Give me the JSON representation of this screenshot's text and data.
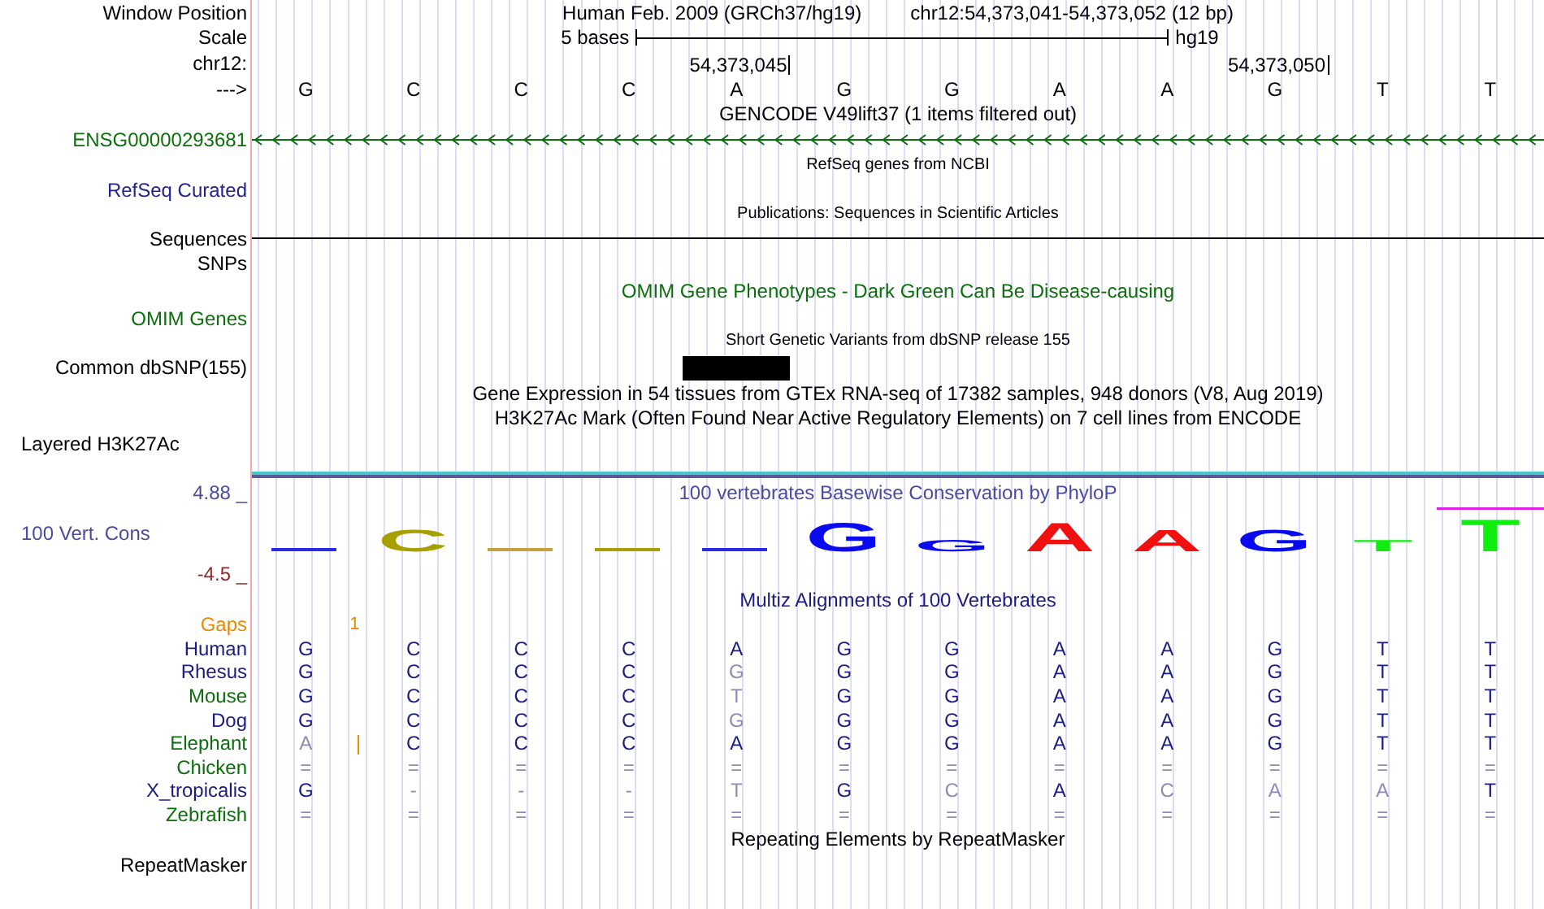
{
  "position": {
    "label": "Window Position",
    "assembly": "Human Feb. 2009 (GRCh37/hg19)",
    "range": "chr12:54,373,041-54,373,052 (12 bp)"
  },
  "scale": {
    "label": "Scale",
    "length": "5 bases",
    "assembly": "hg19"
  },
  "coordinates": {
    "label": "chr12:",
    "ticks": [
      "54,373,045",
      "54,373,050"
    ]
  },
  "bases": {
    "label": "--->",
    "letters": [
      "G",
      "C",
      "C",
      "C",
      "A",
      "G",
      "G",
      "A",
      "A",
      "G",
      "T",
      "T"
    ]
  },
  "gencode": {
    "title": "GENCODE V49lift37 (1 items filtered out)",
    "gene": "ENSG00000293681",
    "color": "#0c6e0c"
  },
  "refseq": {
    "title": "RefSeq genes from NCBI",
    "label": "RefSeq Curated",
    "color": "#23238c"
  },
  "publications": {
    "title": "Publications: Sequences in Scientific Articles",
    "label": "Sequences"
  },
  "snps": {
    "label": "SNPs"
  },
  "omim": {
    "title": "OMIM Gene Phenotypes - Dark Green Can Be Disease-causing",
    "label": "OMIM Genes",
    "color": "#0c6e0c"
  },
  "dbsnp": {
    "title": "Short Genetic Variants from dbSNP release 155",
    "label": "Common dbSNP(155)"
  },
  "gtex": {
    "title": "Gene Expression in 54 tissues from GTEx RNA-seq of 17382 samples, 948 donors (V8, Aug 2019)"
  },
  "h3k27ac": {
    "title": "H3K27Ac Mark (Often Found Near Active Regulatory Elements) on 7 cell lines from ENCODE",
    "label": "Layered H3K27Ac"
  },
  "conservation": {
    "title": "100 vertebrates Basewise Conservation by PhyloP",
    "label": "100 Vert. Cons",
    "max": "4.88 _",
    "min": "-4.5 _",
    "logo": [
      {
        "kind": "flat",
        "color": "#2a2ae0"
      },
      {
        "kind": "mid",
        "letter": "C",
        "color": "#a8a000"
      },
      {
        "kind": "flat",
        "color": "#c8a040"
      },
      {
        "kind": "flat",
        "color": "#a8a000"
      },
      {
        "kind": "flat",
        "color": "#2a2ae0"
      },
      {
        "kind": "tall",
        "letter": "G",
        "color": "#0a0af0"
      },
      {
        "kind": "short",
        "letter": "G",
        "color": "#0a0af0"
      },
      {
        "kind": "tall",
        "letter": "A",
        "color": "#f01010"
      },
      {
        "kind": "mid",
        "letter": "A",
        "color": "#f01010"
      },
      {
        "kind": "mid",
        "letter": "G",
        "color": "#0a0af0"
      },
      {
        "kind": "short",
        "letter": "T",
        "color": "#10ee10"
      },
      {
        "kind": "clipped",
        "letter": "T",
        "color": "#10ee10"
      }
    ]
  },
  "multiz": {
    "title": "Multiz Alignments of 100 Vertebrates",
    "gaps": {
      "label": "Gaps",
      "counts": [
        "1"
      ]
    },
    "species": [
      {
        "name": "Human",
        "color": "#1c1c80",
        "insertion": false,
        "bases": [
          {
            "b": "G",
            "faded": false
          },
          {
            "b": "C",
            "faded": false
          },
          {
            "b": "C",
            "faded": false
          },
          {
            "b": "C",
            "faded": false
          },
          {
            "b": "A",
            "faded": false
          },
          {
            "b": "G",
            "faded": false
          },
          {
            "b": "G",
            "faded": false
          },
          {
            "b": "A",
            "faded": false
          },
          {
            "b": "A",
            "faded": false
          },
          {
            "b": "G",
            "faded": false
          },
          {
            "b": "T",
            "faded": false
          },
          {
            "b": "T",
            "faded": false
          }
        ]
      },
      {
        "name": "Rhesus",
        "color": "#1c1c80",
        "insertion": false,
        "bases": [
          {
            "b": "G",
            "faded": false
          },
          {
            "b": "C",
            "faded": false
          },
          {
            "b": "C",
            "faded": false
          },
          {
            "b": "C",
            "faded": false
          },
          {
            "b": "G",
            "faded": true
          },
          {
            "b": "G",
            "faded": false
          },
          {
            "b": "G",
            "faded": false
          },
          {
            "b": "A",
            "faded": false
          },
          {
            "b": "A",
            "faded": false
          },
          {
            "b": "G",
            "faded": false
          },
          {
            "b": "T",
            "faded": false
          },
          {
            "b": "T",
            "faded": false
          }
        ]
      },
      {
        "name": "Mouse",
        "color": "#0c6e0c",
        "insertion": false,
        "bases": [
          {
            "b": "G",
            "faded": false
          },
          {
            "b": "C",
            "faded": false
          },
          {
            "b": "C",
            "faded": false
          },
          {
            "b": "C",
            "faded": false
          },
          {
            "b": "T",
            "faded": true
          },
          {
            "b": "G",
            "faded": false
          },
          {
            "b": "G",
            "faded": false
          },
          {
            "b": "A",
            "faded": false
          },
          {
            "b": "A",
            "faded": false
          },
          {
            "b": "G",
            "faded": false
          },
          {
            "b": "T",
            "faded": false
          },
          {
            "b": "T",
            "faded": false
          }
        ]
      },
      {
        "name": "Dog",
        "color": "#1c1c80",
        "insertion": false,
        "bases": [
          {
            "b": "G",
            "faded": false
          },
          {
            "b": "C",
            "faded": false
          },
          {
            "b": "C",
            "faded": false
          },
          {
            "b": "C",
            "faded": false
          },
          {
            "b": "G",
            "faded": true
          },
          {
            "b": "G",
            "faded": false
          },
          {
            "b": "G",
            "faded": false
          },
          {
            "b": "A",
            "faded": false
          },
          {
            "b": "A",
            "faded": false
          },
          {
            "b": "G",
            "faded": false
          },
          {
            "b": "T",
            "faded": false
          },
          {
            "b": "T",
            "faded": false
          }
        ]
      },
      {
        "name": "Elephant",
        "color": "#0c6e0c",
        "insertion": true,
        "bases": [
          {
            "b": "A",
            "faded": true
          },
          {
            "b": "C",
            "faded": false
          },
          {
            "b": "C",
            "faded": false
          },
          {
            "b": "C",
            "faded": false
          },
          {
            "b": "A",
            "faded": false
          },
          {
            "b": "G",
            "faded": false
          },
          {
            "b": "G",
            "faded": false
          },
          {
            "b": "A",
            "faded": false
          },
          {
            "b": "A",
            "faded": false
          },
          {
            "b": "G",
            "faded": false
          },
          {
            "b": "T",
            "faded": false
          },
          {
            "b": "T",
            "faded": false
          }
        ]
      },
      {
        "name": "Chicken",
        "color": "#0c6e0c",
        "insertion": false,
        "bases": [
          {
            "b": "=",
            "faded": true
          },
          {
            "b": "=",
            "faded": true
          },
          {
            "b": "=",
            "faded": true
          },
          {
            "b": "=",
            "faded": true
          },
          {
            "b": "=",
            "faded": true
          },
          {
            "b": "=",
            "faded": true
          },
          {
            "b": "=",
            "faded": true
          },
          {
            "b": "=",
            "faded": true
          },
          {
            "b": "=",
            "faded": true
          },
          {
            "b": "=",
            "faded": true
          },
          {
            "b": "=",
            "faded": true
          },
          {
            "b": "=",
            "faded": true
          }
        ]
      },
      {
        "name": "X_tropicalis",
        "color": "#1c1c80",
        "insertion": false,
        "bases": [
          {
            "b": "G",
            "faded": false
          },
          {
            "b": "-",
            "faded": true
          },
          {
            "b": "-",
            "faded": true
          },
          {
            "b": "-",
            "faded": true
          },
          {
            "b": "T",
            "faded": true
          },
          {
            "b": "G",
            "faded": false
          },
          {
            "b": "C",
            "faded": true
          },
          {
            "b": "A",
            "faded": false
          },
          {
            "b": "C",
            "faded": true
          },
          {
            "b": "A",
            "faded": true
          },
          {
            "b": "A",
            "faded": true
          },
          {
            "b": "T",
            "faded": false
          }
        ]
      },
      {
        "name": "Zebrafish",
        "color": "#0c6e0c",
        "insertion": false,
        "bases": [
          {
            "b": "=",
            "faded": true
          },
          {
            "b": "=",
            "faded": true
          },
          {
            "b": "=",
            "faded": true
          },
          {
            "b": "=",
            "faded": true
          },
          {
            "b": "=",
            "faded": true
          },
          {
            "b": "=",
            "faded": true
          },
          {
            "b": "=",
            "faded": true
          },
          {
            "b": "=",
            "faded": true
          },
          {
            "b": "=",
            "faded": true
          },
          {
            "b": "=",
            "faded": true
          },
          {
            "b": "=",
            "faded": true
          },
          {
            "b": "=",
            "faded": true
          }
        ]
      }
    ]
  },
  "repeatmasker": {
    "title": "Repeating Elements by RepeatMasker",
    "label": "RepeatMasker"
  }
}
